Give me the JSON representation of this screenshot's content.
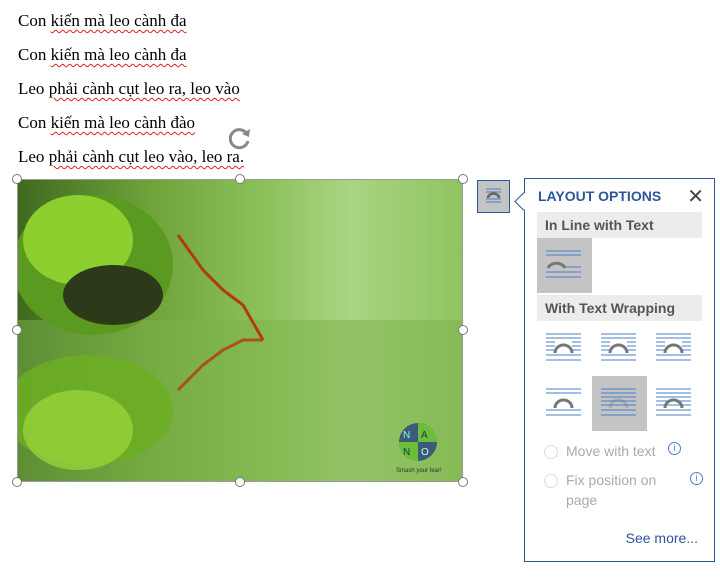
{
  "document": {
    "lines": [
      {
        "pre": "Con ",
        "sq": "kiến mà leo cành đa",
        "post": ""
      },
      {
        "pre": "Con ",
        "sq": "kiến mà leo cành đa",
        "post": ""
      },
      {
        "pre": "Leo ",
        "sq": "phải cành cụt leo ra, leo vào",
        "post": ""
      },
      {
        "pre": "Con ",
        "sq": "kiến mà leo cành đào",
        "post": ""
      },
      {
        "pre": "Leo ",
        "sq": "phải cành cụt leo vào, leo ra.",
        "post": ""
      }
    ]
  },
  "image": {
    "logo_letters": [
      "N",
      "A",
      "N",
      "O"
    ],
    "logo_tagline": "Smash your fear!"
  },
  "layout_options": {
    "title": "LAYOUT OPTIONS",
    "close_icon": "close-icon",
    "inline_header": "In Line with Text",
    "wrap_header": "With Text Wrapping",
    "wrap_options": [
      "Square",
      "Tight",
      "Through",
      "Top and Bottom",
      "Behind Text",
      "In Front of Text"
    ],
    "selected_wrap": "Behind Text",
    "move_with_text": "Move with text",
    "fix_position": "Fix position on",
    "fix_position_2": "page",
    "see_more": "See more...",
    "accent": "#2b579a"
  }
}
